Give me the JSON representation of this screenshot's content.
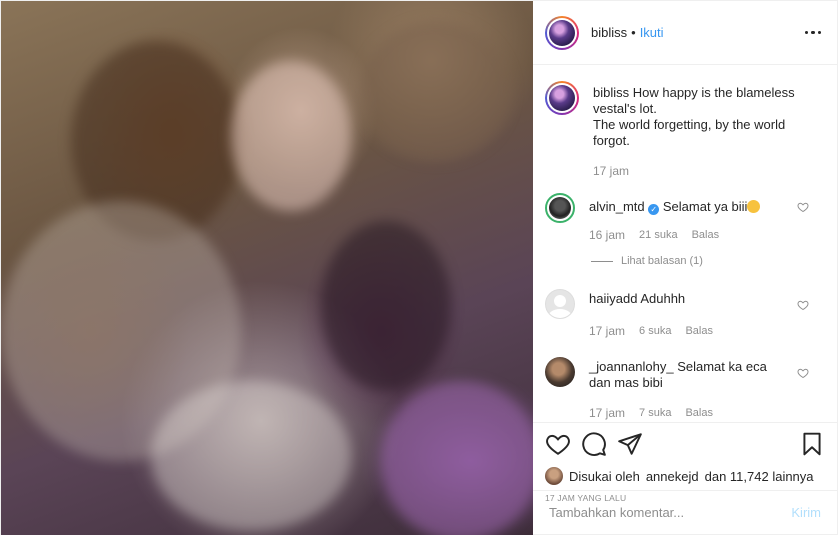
{
  "header": {
    "username": "bibliss",
    "separator": "•",
    "follow_label": "Ikuti",
    "more_icon": "more-horizontal-icon"
  },
  "caption": {
    "username": "bibliss",
    "text_line1": "How happy is the blameless vestal's lot.",
    "text_line2": "The world forgetting, by the world forgot.",
    "time": "17 jam"
  },
  "comments": [
    {
      "username": "alvin_mtd",
      "verified": true,
      "text": "Selamat ya biii",
      "emoji": "smiling-face-emoji",
      "time": "16 jam",
      "likes": "21 suka",
      "reply_label": "Balas",
      "view_replies": "Lihat balasan (1)"
    },
    {
      "username": "haiiyadd",
      "text": "Aduhhh",
      "time": "17 jam",
      "likes": "6 suka",
      "reply_label": "Balas"
    },
    {
      "username": "_joannanlohy_",
      "text": "Selamat ka eca dan mas bibi",
      "time": "17 jam",
      "likes": "7 suka",
      "reply_label": "Balas"
    }
  ],
  "actions": {
    "liked_by_prefix": "Disukai oleh",
    "liked_by_user": "annekejd",
    "liked_by_suffix": "dan 11,742 lainnya",
    "time_ago": "17 JAM YANG LALU"
  },
  "add_comment": {
    "placeholder": "Tambahkan komentar...",
    "post_label": "Kirim"
  },
  "colors": {
    "accent": "#3897f0",
    "post_disabled": "#b2dffc",
    "muted": "#8e8e8e"
  }
}
